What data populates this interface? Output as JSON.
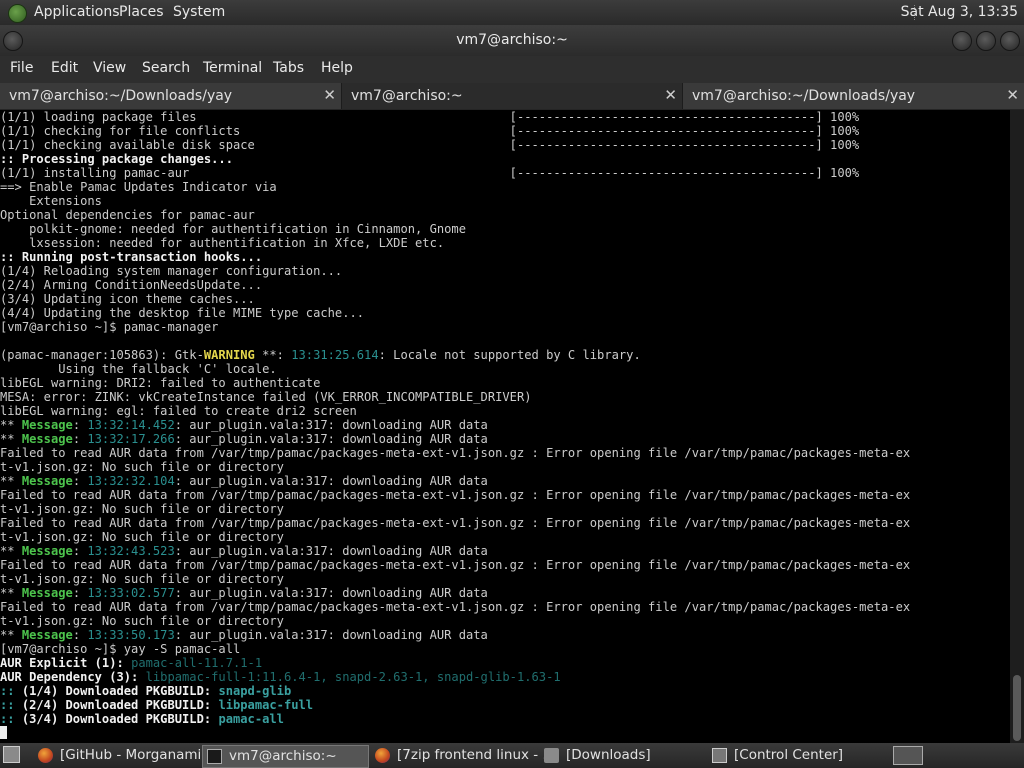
{
  "top_panel": {
    "menus": [
      "Applications",
      "Places",
      "System"
    ],
    "clock": "Sat Aug  3, 13:35"
  },
  "window": {
    "title": "vm7@archiso:~"
  },
  "menubar": [
    "File",
    "Edit",
    "View",
    "Search",
    "Terminal",
    "Tabs",
    "Help"
  ],
  "tabs": [
    {
      "label": "vm7@archiso:~/Downloads/yay",
      "active": false
    },
    {
      "label": "vm7@archiso:~",
      "active": true
    },
    {
      "label": "vm7@archiso:~/Downloads/yay",
      "active": false
    }
  ],
  "tab_close": "✕",
  "terminal_lines": [
    [
      {
        "t": "(1/1) loading package files                                           [-----------------------------------------] 100%"
      }
    ],
    [
      {
        "t": "(1/1) checking for file conflicts                                     [-----------------------------------------] 100%"
      }
    ],
    [
      {
        "t": "(1/1) checking available disk space                                   [-----------------------------------------] 100%"
      }
    ],
    [
      {
        "t": ":: Processing package changes...",
        "s": "b"
      }
    ],
    [
      {
        "t": "(1/1) installing pamac-aur                                            [-----------------------------------------] 100%"
      }
    ],
    [
      {
        "t": "==> Enable Pamac Updates Indicator via"
      }
    ],
    [
      {
        "t": "    Extensions"
      }
    ],
    [
      {
        "t": "Optional dependencies for pamac-aur"
      }
    ],
    [
      {
        "t": "    polkit-gnome: needed for authentification in Cinnamon, Gnome"
      }
    ],
    [
      {
        "t": "    lxsession: needed for authentification in Xfce, LXDE etc."
      }
    ],
    [
      {
        "t": ":: Running post-transaction hooks...",
        "s": "b"
      }
    ],
    [
      {
        "t": "(1/4) Reloading system manager configuration..."
      }
    ],
    [
      {
        "t": "(2/4) Arming ConditionNeedsUpdate..."
      }
    ],
    [
      {
        "t": "(3/4) Updating icon theme caches..."
      }
    ],
    [
      {
        "t": "(4/4) Updating the desktop file MIME type cache..."
      }
    ],
    [
      {
        "t": "[vm7@archiso ~]$ pamac-manager"
      }
    ],
    [
      {
        "t": ""
      }
    ],
    [
      {
        "t": "(pamac-manager:105863): Gtk-"
      },
      {
        "t": "WARNING",
        "s": "y"
      },
      {
        "t": " **: "
      },
      {
        "t": "13:31:25.614",
        "s": "c"
      },
      {
        "t": ": Locale not supported by C library."
      }
    ],
    [
      {
        "t": "        Using the fallback 'C' locale."
      }
    ],
    [
      {
        "t": "libEGL warning: DRI2: failed to authenticate"
      }
    ],
    [
      {
        "t": "MESA: error: ZINK: vkCreateInstance failed (VK_ERROR_INCOMPATIBLE_DRIVER)"
      }
    ],
    [
      {
        "t": "libEGL warning: egl: failed to create dri2 screen"
      }
    ],
    [
      {
        "t": "** "
      },
      {
        "t": "Message",
        "s": "g"
      },
      {
        "t": ": "
      },
      {
        "t": "13:32:14.452",
        "s": "c"
      },
      {
        "t": ": aur_plugin.vala:317: downloading AUR data"
      }
    ],
    [
      {
        "t": "** "
      },
      {
        "t": "Message",
        "s": "g"
      },
      {
        "t": ": "
      },
      {
        "t": "13:32:17.266",
        "s": "c"
      },
      {
        "t": ": aur_plugin.vala:317: downloading AUR data"
      }
    ],
    [
      {
        "t": "Failed to read AUR data from /var/tmp/pamac/packages-meta-ext-v1.json.gz : Error opening file /var/tmp/pamac/packages-meta-ex"
      }
    ],
    [
      {
        "t": "t-v1.json.gz: No such file or directory"
      }
    ],
    [
      {
        "t": "** "
      },
      {
        "t": "Message",
        "s": "g"
      },
      {
        "t": ": "
      },
      {
        "t": "13:32:32.104",
        "s": "c"
      },
      {
        "t": ": aur_plugin.vala:317: downloading AUR data"
      }
    ],
    [
      {
        "t": "Failed to read AUR data from /var/tmp/pamac/packages-meta-ext-v1.json.gz : Error opening file /var/tmp/pamac/packages-meta-ex"
      }
    ],
    [
      {
        "t": "t-v1.json.gz: No such file or directory"
      }
    ],
    [
      {
        "t": "Failed to read AUR data from /var/tmp/pamac/packages-meta-ext-v1.json.gz : Error opening file /var/tmp/pamac/packages-meta-ex"
      }
    ],
    [
      {
        "t": "t-v1.json.gz: No such file or directory"
      }
    ],
    [
      {
        "t": "** "
      },
      {
        "t": "Message",
        "s": "g"
      },
      {
        "t": ": "
      },
      {
        "t": "13:32:43.523",
        "s": "c"
      },
      {
        "t": ": aur_plugin.vala:317: downloading AUR data"
      }
    ],
    [
      {
        "t": "Failed to read AUR data from /var/tmp/pamac/packages-meta-ext-v1.json.gz : Error opening file /var/tmp/pamac/packages-meta-ex"
      }
    ],
    [
      {
        "t": "t-v1.json.gz: No such file or directory"
      }
    ],
    [
      {
        "t": "** "
      },
      {
        "t": "Message",
        "s": "g"
      },
      {
        "t": ": "
      },
      {
        "t": "13:33:02.577",
        "s": "c"
      },
      {
        "t": ": aur_plugin.vala:317: downloading AUR data"
      }
    ],
    [
      {
        "t": "Failed to read AUR data from /var/tmp/pamac/packages-meta-ext-v1.json.gz : Error opening file /var/tmp/pamac/packages-meta-ex"
      }
    ],
    [
      {
        "t": "t-v1.json.gz: No such file or directory"
      }
    ],
    [
      {
        "t": "** "
      },
      {
        "t": "Message",
        "s": "g"
      },
      {
        "t": ": "
      },
      {
        "t": "13:33:50.173",
        "s": "c"
      },
      {
        "t": ": aur_plugin.vala:317: downloading AUR data"
      }
    ],
    [
      {
        "t": "[vm7@archiso ~]$ yay -S pamac-all"
      }
    ],
    [
      {
        "t": "AUR Explicit (1): ",
        "s": "b"
      },
      {
        "t": "pamac-all-11.7.1-1",
        "s": "cn"
      }
    ],
    [
      {
        "t": "AUR Dependency (3): ",
        "s": "b"
      },
      {
        "t": "libpamac-full-1:11.6.4-1, snapd-2.63-1, snapd-glib-1.63-1",
        "s": "cn"
      }
    ],
    [
      {
        "t": ":: ",
        "s": "cb"
      },
      {
        "t": "(1/4) Downloaded PKGBUILD: ",
        "s": "b"
      },
      {
        "t": "snapd-glib",
        "s": "cb"
      }
    ],
    [
      {
        "t": ":: ",
        "s": "cb"
      },
      {
        "t": "(2/4) Downloaded PKGBUILD: ",
        "s": "b"
      },
      {
        "t": "libpamac-full",
        "s": "cb"
      }
    ],
    [
      {
        "t": ":: ",
        "s": "cb"
      },
      {
        "t": "(3/4) Downloaded PKGBUILD: ",
        "s": "b"
      },
      {
        "t": "pamac-all",
        "s": "cb"
      }
    ]
  ],
  "taskbar": [
    {
      "label": "[GitHub - Morganamil...",
      "icon": "firefox-icon",
      "active": false
    },
    {
      "label": "vm7@archiso:~",
      "icon": "terminal-icon",
      "active": true
    },
    {
      "label": "[7zip frontend linux - ...",
      "icon": "firefox-icon",
      "active": false
    },
    {
      "label": "[Downloads]",
      "icon": "folder-icon",
      "active": false
    },
    {
      "label": "[Control Center]",
      "icon": "control-center-icon",
      "active": false
    }
  ]
}
